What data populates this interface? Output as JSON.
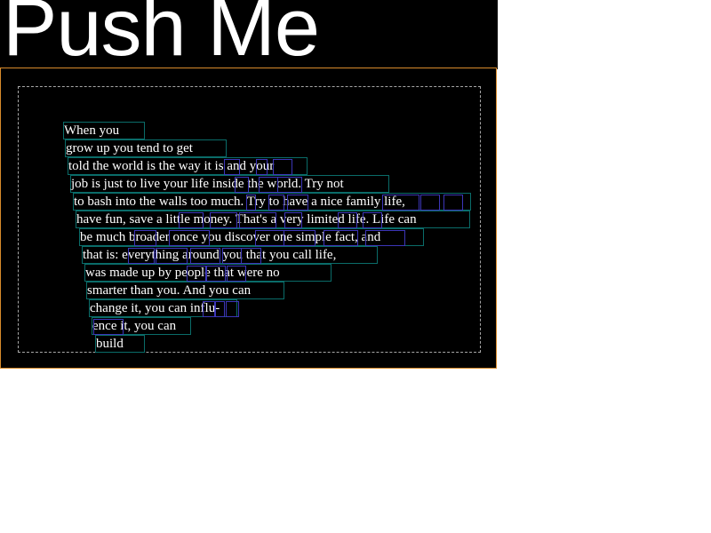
{
  "button": {
    "label": "Push Me"
  },
  "paragraph": {
    "lines": [
      "When you",
      "grow up you tend to get",
      "told the world is the way it is and your",
      "job is just to live your life inside the world. Try not",
      "to bash into the walls too much. Try to have a nice family life,",
      "have fun, save a little money. That's a very limited life. Life can",
      "be much broader once you discover one simple fact, and",
      "that is: everything around you that you call life,",
      "was made up by people that were no",
      "smarter than you. And you can",
      "change it, you can influ-",
      "ence it, you can",
      "build"
    ]
  },
  "colors": {
    "background": "#000000",
    "text": "#ffffff",
    "panel_border": "#d98b2b",
    "line_box": "#0a6c69",
    "word_box": "#3c36b8"
  }
}
